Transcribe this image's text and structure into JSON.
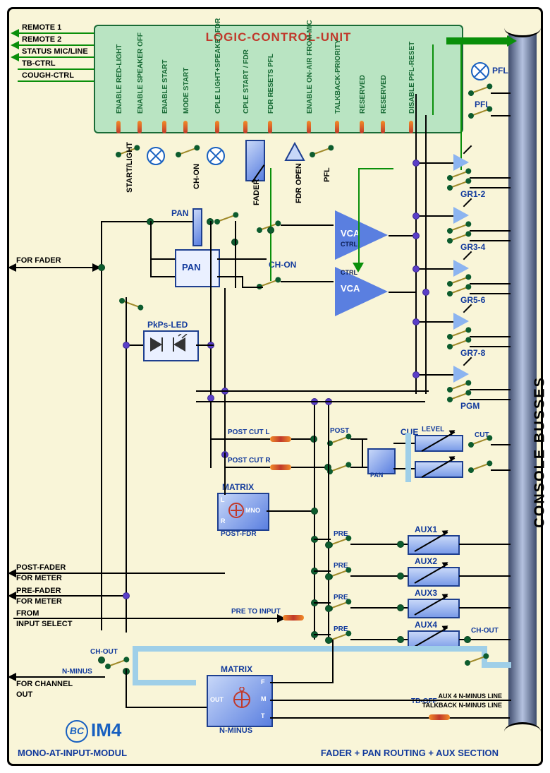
{
  "header": {
    "lcu_title": "LOGIC-CONTROL-UNIT",
    "lcu_pins": [
      "ENABLE RED-LIGHT",
      "ENABLE SPEAKER OFF",
      "ENABLE START",
      "MODE START",
      "CPLE  LIGHT+SPEAKE / FDR",
      "CPLE  START / FDR",
      "FDR RESETS PFL",
      "ENABLE ON-AIR  FROM MIC",
      "TALKBACK-PRIORITY",
      "RESERVED",
      "RESERVED",
      "DISABLE PFL-RESET"
    ],
    "ext_left": [
      "REMOTE 1",
      "REMOTE 2",
      "STATUS MIC/LINE",
      "TB-CTRL",
      "COUGH-CTRL"
    ]
  },
  "below_lcu": {
    "start_light": "START/LIGHT",
    "ch_on": "CH-ON",
    "fader": "FADER",
    "fdr_open": "FDR OPEN",
    "pfl_small": "PFL"
  },
  "pfl": {
    "label": "PFL",
    "label2": "PFL"
  },
  "pan": {
    "title": "PAN",
    "box": "PAN"
  },
  "for_fader": "FOR FADER",
  "ch_on": "CH-ON",
  "vca": {
    "top": "VCA",
    "top_ctrl": "CTRL",
    "bot": "VCA",
    "bot_ctrl": "CTRL"
  },
  "bus_groups": [
    "GR1-2",
    "GR3-4",
    "GR5-6",
    "GR7-8",
    "PGM"
  ],
  "pkps": {
    "title": "PkPs-LED"
  },
  "postcut": {
    "l": "POST CUT L",
    "r": "POST CUT R",
    "post": "POST"
  },
  "cue": {
    "title": "CUE",
    "level": "LEVEL",
    "pan": "PAN",
    "cut": "CUT"
  },
  "matrix1": {
    "title": "MATRIX",
    "l": "L",
    "r": "R",
    "mno": "MNO",
    "foot": "POST-FDR"
  },
  "pre": {
    "p1": "PRE",
    "p2": "PRE",
    "p3": "PRE",
    "p4": "PRE",
    "pre_to_input": "PRE TO INPUT"
  },
  "aux": [
    "AUX1",
    "AUX2",
    "AUX3",
    "AUX4"
  ],
  "left_labels": {
    "post_fader": "POST-FADER",
    "for_meter1": "FOR METER",
    "pre_fader": "PRE-FADER",
    "for_meter2": "FOR METER",
    "from": "FROM",
    "input_select": "INPUT SELECT",
    "for_channel": "FOR CHANNEL",
    "out": "OUT",
    "ch_out": "CH-OUT",
    "n_minus": "N-MINUS"
  },
  "ch_out_r": "CH-OUT",
  "matrix2": {
    "title": "MATRIX",
    "out": "OUT",
    "f": "F",
    "m": "M",
    "t": "T",
    "foot": "N-MINUS"
  },
  "tb_off": "TB-OFF",
  "nminus_lines": {
    "l1": "AUX 4 N-MINUS LINE",
    "l2": "TALKBACK N-MINUS LINE"
  },
  "bus_title": "CONSOLE BUSSES",
  "footer": {
    "left": "MONO-AT-INPUT-MODUL",
    "right": "FADER + PAN  ROUTING + AUX SECTION",
    "logo": "IM4"
  }
}
